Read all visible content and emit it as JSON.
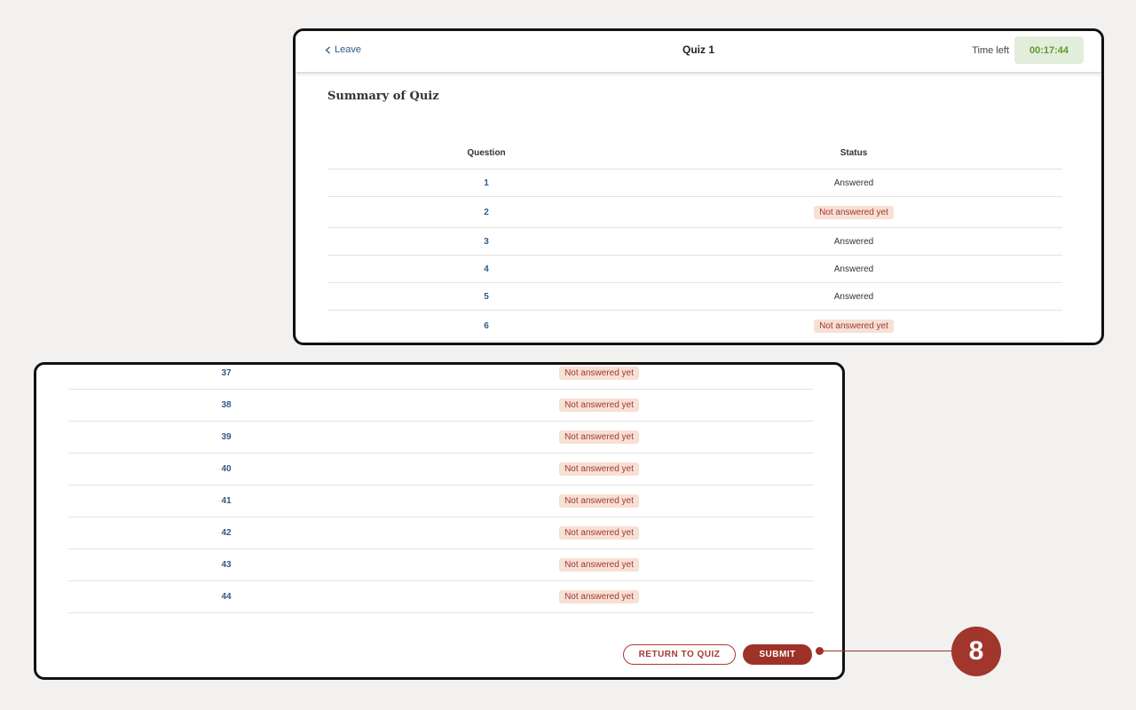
{
  "header": {
    "leave_label": "Leave",
    "title": "Quiz 1",
    "time_left_label": "Time left",
    "time_left_value": "00:17:44"
  },
  "summary_title": "Summary of Quiz",
  "table": {
    "col_question": "Question",
    "col_status": "Status"
  },
  "rows_top": [
    {
      "number": "1",
      "status": "Answered",
      "answered": true
    },
    {
      "number": "2",
      "status": "Not answered yet",
      "answered": false
    },
    {
      "number": "3",
      "status": "Answered",
      "answered": true
    },
    {
      "number": "4",
      "status": "Answered",
      "answered": true
    },
    {
      "number": "5",
      "status": "Answered",
      "answered": true
    },
    {
      "number": "6",
      "status": "Not answered yet",
      "answered": false
    }
  ],
  "rows_bottom": [
    {
      "number": "37",
      "status": "Not answered yet",
      "answered": false
    },
    {
      "number": "38",
      "status": "Not answered yet",
      "answered": false
    },
    {
      "number": "39",
      "status": "Not answered yet",
      "answered": false
    },
    {
      "number": "40",
      "status": "Not answered yet",
      "answered": false
    },
    {
      "number": "41",
      "status": "Not answered yet",
      "answered": false
    },
    {
      "number": "42",
      "status": "Not answered yet",
      "answered": false
    },
    {
      "number": "43",
      "status": "Not answered yet",
      "answered": false
    },
    {
      "number": "44",
      "status": "Not answered yet",
      "answered": false
    }
  ],
  "buttons": {
    "return_label": "RETURN TO QUIZ",
    "submit_label": "SUBMIT"
  },
  "callout": {
    "number": "8"
  },
  "colors": {
    "accent": "#9e3228",
    "link": "#2c5a8a",
    "timer_bg": "#e2eedb",
    "timer_text": "#5a9a2c",
    "badge_bg": "#f7e0d6",
    "badge_text": "#a6382c"
  }
}
